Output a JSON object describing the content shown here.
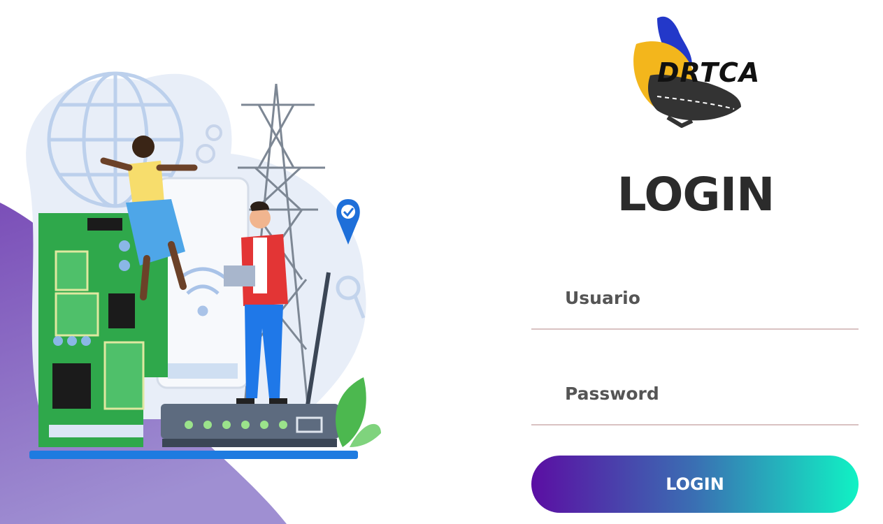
{
  "brand": {
    "logo_text": "DRTCA"
  },
  "login": {
    "title": "LOGIN",
    "username_placeholder": "Usuario",
    "password_placeholder": "Password",
    "button_label": "LOGIN"
  },
  "colors": {
    "title_text": "#2b2b2b",
    "field_underline": "#d9c2c2",
    "button_gradient_start": "#5b0ea3",
    "button_gradient_end": "#10f2c4",
    "left_blob": "#8e6fc4"
  },
  "icons": {
    "illustration": "tech-network-illustration",
    "logo": "drtca-map-logo"
  }
}
